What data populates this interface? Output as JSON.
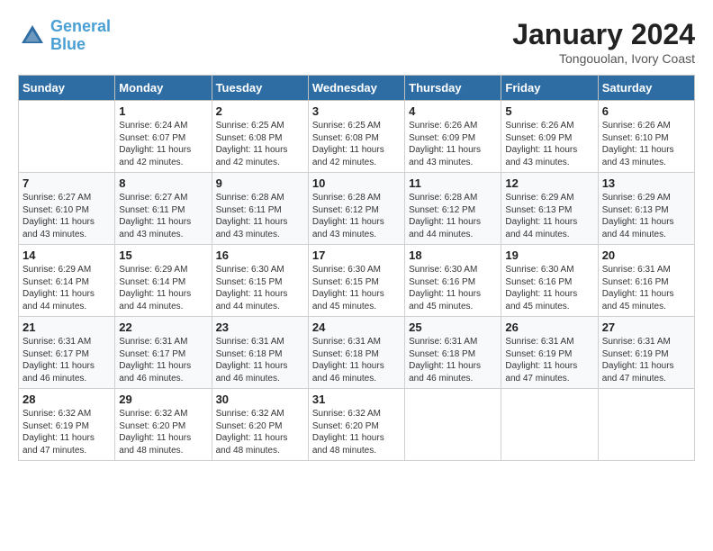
{
  "header": {
    "logo_line1": "General",
    "logo_line2": "Blue",
    "month": "January 2024",
    "location": "Tongouolan, Ivory Coast"
  },
  "weekdays": [
    "Sunday",
    "Monday",
    "Tuesday",
    "Wednesday",
    "Thursday",
    "Friday",
    "Saturday"
  ],
  "weeks": [
    [
      {
        "day": "",
        "sunrise": "",
        "sunset": "",
        "daylight": ""
      },
      {
        "day": "1",
        "sunrise": "Sunrise: 6:24 AM",
        "sunset": "Sunset: 6:07 PM",
        "daylight": "Daylight: 11 hours and 42 minutes."
      },
      {
        "day": "2",
        "sunrise": "Sunrise: 6:25 AM",
        "sunset": "Sunset: 6:08 PM",
        "daylight": "Daylight: 11 hours and 42 minutes."
      },
      {
        "day": "3",
        "sunrise": "Sunrise: 6:25 AM",
        "sunset": "Sunset: 6:08 PM",
        "daylight": "Daylight: 11 hours and 42 minutes."
      },
      {
        "day": "4",
        "sunrise": "Sunrise: 6:26 AM",
        "sunset": "Sunset: 6:09 PM",
        "daylight": "Daylight: 11 hours and 43 minutes."
      },
      {
        "day": "5",
        "sunrise": "Sunrise: 6:26 AM",
        "sunset": "Sunset: 6:09 PM",
        "daylight": "Daylight: 11 hours and 43 minutes."
      },
      {
        "day": "6",
        "sunrise": "Sunrise: 6:26 AM",
        "sunset": "Sunset: 6:10 PM",
        "daylight": "Daylight: 11 hours and 43 minutes."
      }
    ],
    [
      {
        "day": "7",
        "sunrise": "Sunrise: 6:27 AM",
        "sunset": "Sunset: 6:10 PM",
        "daylight": "Daylight: 11 hours and 43 minutes."
      },
      {
        "day": "8",
        "sunrise": "Sunrise: 6:27 AM",
        "sunset": "Sunset: 6:11 PM",
        "daylight": "Daylight: 11 hours and 43 minutes."
      },
      {
        "day": "9",
        "sunrise": "Sunrise: 6:28 AM",
        "sunset": "Sunset: 6:11 PM",
        "daylight": "Daylight: 11 hours and 43 minutes."
      },
      {
        "day": "10",
        "sunrise": "Sunrise: 6:28 AM",
        "sunset": "Sunset: 6:12 PM",
        "daylight": "Daylight: 11 hours and 43 minutes."
      },
      {
        "day": "11",
        "sunrise": "Sunrise: 6:28 AM",
        "sunset": "Sunset: 6:12 PM",
        "daylight": "Daylight: 11 hours and 44 minutes."
      },
      {
        "day": "12",
        "sunrise": "Sunrise: 6:29 AM",
        "sunset": "Sunset: 6:13 PM",
        "daylight": "Daylight: 11 hours and 44 minutes."
      },
      {
        "day": "13",
        "sunrise": "Sunrise: 6:29 AM",
        "sunset": "Sunset: 6:13 PM",
        "daylight": "Daylight: 11 hours and 44 minutes."
      }
    ],
    [
      {
        "day": "14",
        "sunrise": "Sunrise: 6:29 AM",
        "sunset": "Sunset: 6:14 PM",
        "daylight": "Daylight: 11 hours and 44 minutes."
      },
      {
        "day": "15",
        "sunrise": "Sunrise: 6:29 AM",
        "sunset": "Sunset: 6:14 PM",
        "daylight": "Daylight: 11 hours and 44 minutes."
      },
      {
        "day": "16",
        "sunrise": "Sunrise: 6:30 AM",
        "sunset": "Sunset: 6:15 PM",
        "daylight": "Daylight: 11 hours and 44 minutes."
      },
      {
        "day": "17",
        "sunrise": "Sunrise: 6:30 AM",
        "sunset": "Sunset: 6:15 PM",
        "daylight": "Daylight: 11 hours and 45 minutes."
      },
      {
        "day": "18",
        "sunrise": "Sunrise: 6:30 AM",
        "sunset": "Sunset: 6:16 PM",
        "daylight": "Daylight: 11 hours and 45 minutes."
      },
      {
        "day": "19",
        "sunrise": "Sunrise: 6:30 AM",
        "sunset": "Sunset: 6:16 PM",
        "daylight": "Daylight: 11 hours and 45 minutes."
      },
      {
        "day": "20",
        "sunrise": "Sunrise: 6:31 AM",
        "sunset": "Sunset: 6:16 PM",
        "daylight": "Daylight: 11 hours and 45 minutes."
      }
    ],
    [
      {
        "day": "21",
        "sunrise": "Sunrise: 6:31 AM",
        "sunset": "Sunset: 6:17 PM",
        "daylight": "Daylight: 11 hours and 46 minutes."
      },
      {
        "day": "22",
        "sunrise": "Sunrise: 6:31 AM",
        "sunset": "Sunset: 6:17 PM",
        "daylight": "Daylight: 11 hours and 46 minutes."
      },
      {
        "day": "23",
        "sunrise": "Sunrise: 6:31 AM",
        "sunset": "Sunset: 6:18 PM",
        "daylight": "Daylight: 11 hours and 46 minutes."
      },
      {
        "day": "24",
        "sunrise": "Sunrise: 6:31 AM",
        "sunset": "Sunset: 6:18 PM",
        "daylight": "Daylight: 11 hours and 46 minutes."
      },
      {
        "day": "25",
        "sunrise": "Sunrise: 6:31 AM",
        "sunset": "Sunset: 6:18 PM",
        "daylight": "Daylight: 11 hours and 46 minutes."
      },
      {
        "day": "26",
        "sunrise": "Sunrise: 6:31 AM",
        "sunset": "Sunset: 6:19 PM",
        "daylight": "Daylight: 11 hours and 47 minutes."
      },
      {
        "day": "27",
        "sunrise": "Sunrise: 6:31 AM",
        "sunset": "Sunset: 6:19 PM",
        "daylight": "Daylight: 11 hours and 47 minutes."
      }
    ],
    [
      {
        "day": "28",
        "sunrise": "Sunrise: 6:32 AM",
        "sunset": "Sunset: 6:19 PM",
        "daylight": "Daylight: 11 hours and 47 minutes."
      },
      {
        "day": "29",
        "sunrise": "Sunrise: 6:32 AM",
        "sunset": "Sunset: 6:20 PM",
        "daylight": "Daylight: 11 hours and 48 minutes."
      },
      {
        "day": "30",
        "sunrise": "Sunrise: 6:32 AM",
        "sunset": "Sunset: 6:20 PM",
        "daylight": "Daylight: 11 hours and 48 minutes."
      },
      {
        "day": "31",
        "sunrise": "Sunrise: 6:32 AM",
        "sunset": "Sunset: 6:20 PM",
        "daylight": "Daylight: 11 hours and 48 minutes."
      },
      {
        "day": "",
        "sunrise": "",
        "sunset": "",
        "daylight": ""
      },
      {
        "day": "",
        "sunrise": "",
        "sunset": "",
        "daylight": ""
      },
      {
        "day": "",
        "sunrise": "",
        "sunset": "",
        "daylight": ""
      }
    ]
  ]
}
